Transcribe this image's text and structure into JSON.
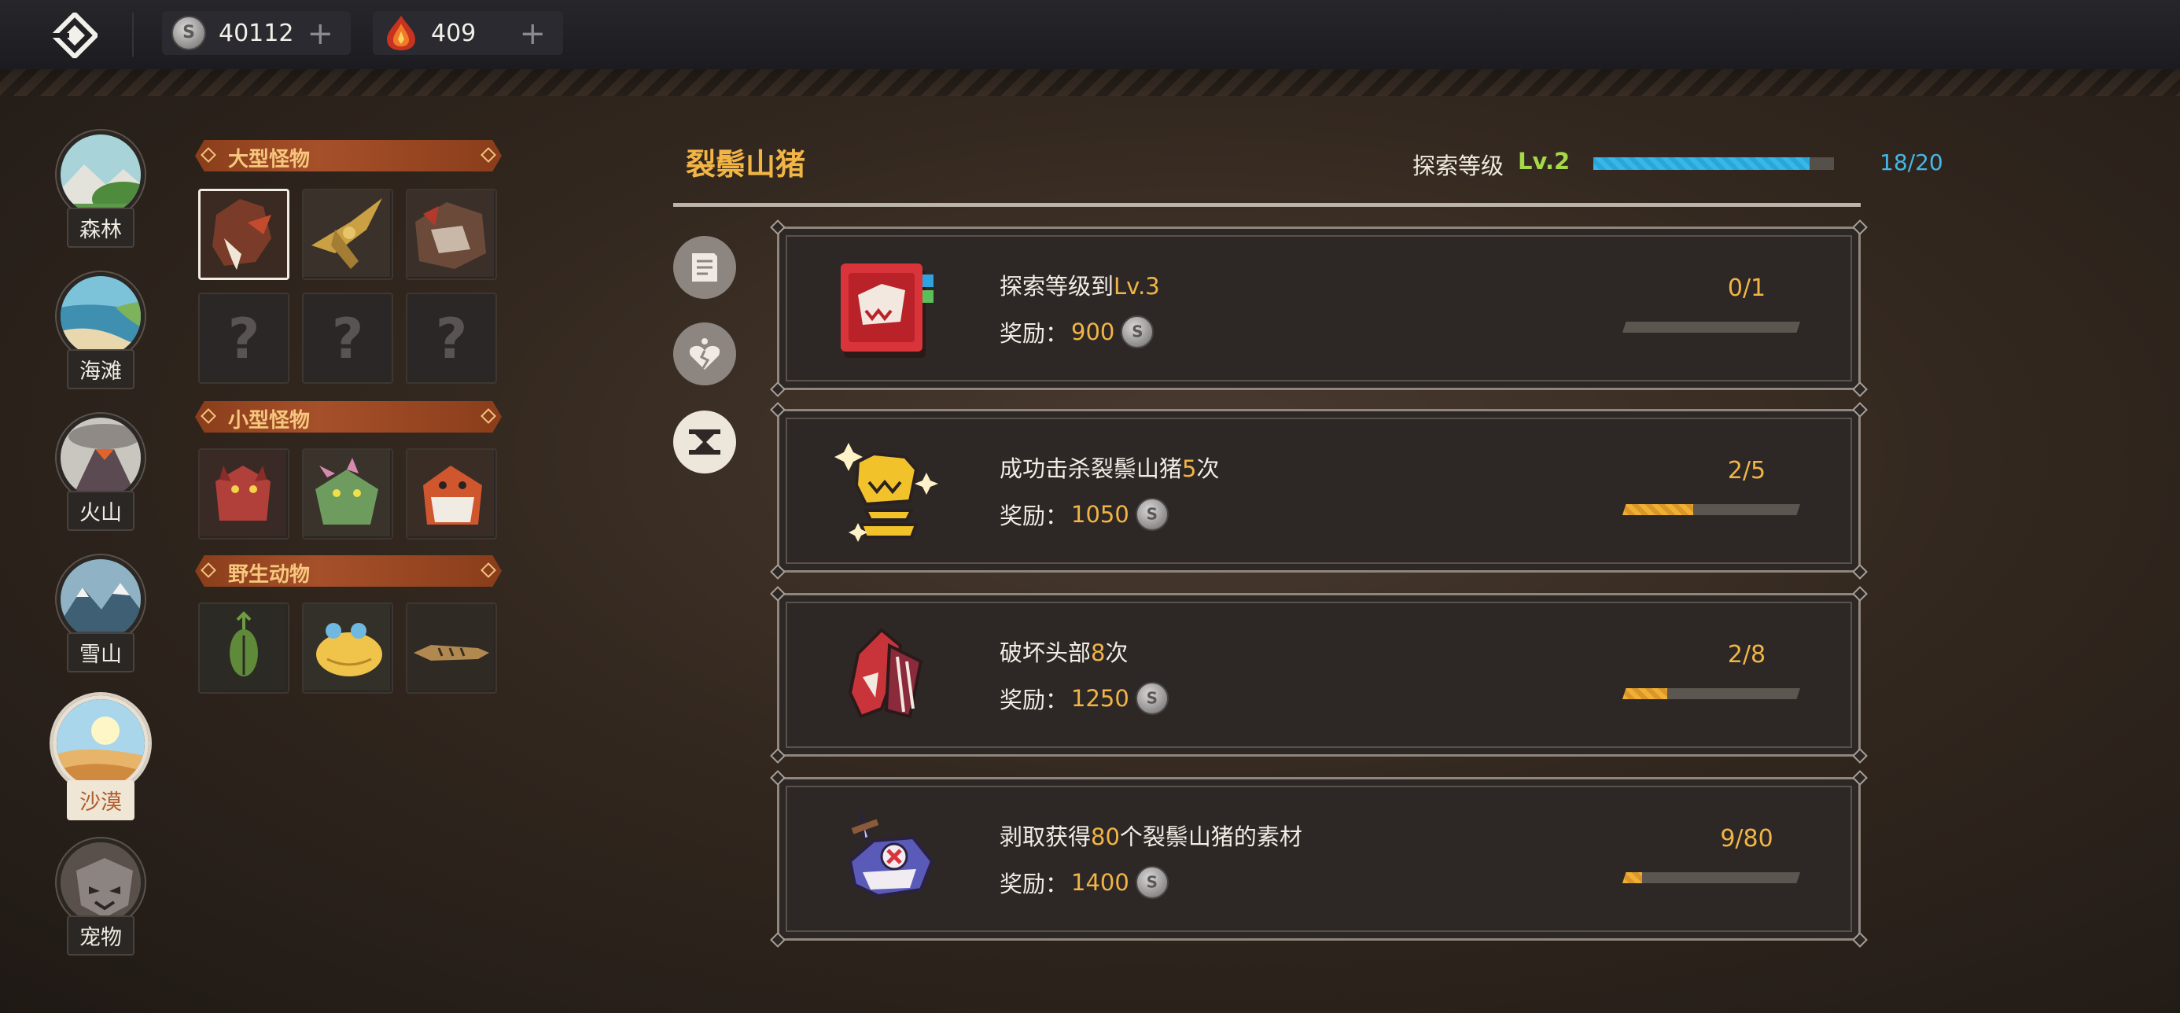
{
  "topbar": {
    "coins": "40112",
    "gems": "409",
    "plus": "+"
  },
  "regions": [
    {
      "label": "森林"
    },
    {
      "label": "海滩"
    },
    {
      "label": "火山"
    },
    {
      "label": "雪山"
    },
    {
      "label": "沙漠"
    },
    {
      "label": "宠物"
    }
  ],
  "categories": {
    "large": "大型怪物",
    "small": "小型怪物",
    "wild": "野生动物"
  },
  "unknown_mark": "?",
  "main": {
    "title": "裂鬃山猪",
    "explore_label": "探索等级",
    "explore_level": "Lv.2",
    "explore_progress": "18/20",
    "explore_fraction": 0.9
  },
  "reward_label": "奖励：",
  "quests": [
    {
      "pre": "探索等级到",
      "hl": "Lv.3",
      "post": "",
      "reward": "900",
      "progress": "0/1",
      "fraction": 0.0
    },
    {
      "pre": "成功击杀裂鬃山猪",
      "hl": "5",
      "post": "次",
      "reward": "1050",
      "progress": "2/5",
      "fraction": 0.4
    },
    {
      "pre": "破坏头部",
      "hl": "8",
      "post": "次",
      "reward": "1250",
      "progress": "2/8",
      "fraction": 0.25
    },
    {
      "pre": "剥取获得",
      "hl": "80",
      "post": "个裂鬃山猪的素材",
      "reward": "1400",
      "progress": "9/80",
      "fraction": 0.1125
    }
  ],
  "colors": {
    "accent": "#f2b545",
    "xp": "#38b7e8",
    "level": "#a6d94a"
  }
}
